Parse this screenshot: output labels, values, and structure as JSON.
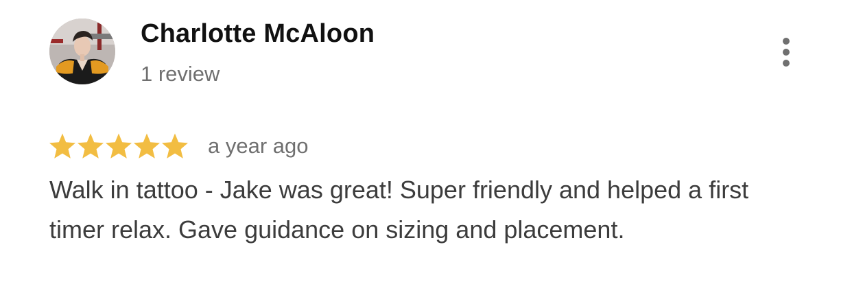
{
  "reviewer": {
    "name": "Charlotte McAloon",
    "review_count": "1 review"
  },
  "avatar": {
    "description_icon": "user-avatar-photo"
  },
  "menu": {
    "icon": "more-vertical-icon"
  },
  "review": {
    "rating": 5,
    "rating_max": 5,
    "date": "a year ago",
    "text": "Walk in tattoo - Jake was great! Super friendly and helped a first timer relax. Gave guidance on sizing and placement."
  },
  "colors": {
    "star": "#f2bd42",
    "name": "#111111",
    "muted": "#6f6f6f",
    "body": "#3c3c3c",
    "menu_dots": "#707070"
  }
}
